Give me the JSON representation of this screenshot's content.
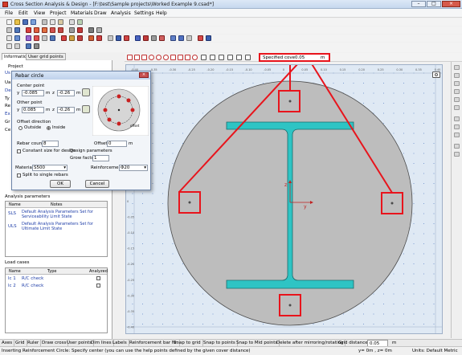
{
  "window": {
    "title": "Cross Section Analysis & Design - [F:\\test\\Sample projects\\Worked Example 9.csad*]",
    "btn_min": "–",
    "btn_max": "□",
    "btn_close": "×"
  },
  "menu": [
    "File",
    "Edit",
    "View",
    "Project",
    "Materials",
    "Draw",
    "Analysis",
    "Settings",
    "Help"
  ],
  "left_tabs": [
    "Information",
    "User grid points"
  ],
  "left_panel": {
    "project_label": "Project",
    "partial_labels": [
      "Us",
      "Ua",
      "De",
      "Ty",
      "Re",
      "Ex",
      "Gr",
      "Ce"
    ],
    "analysis_section": "Analysis parameters",
    "analysis_cols": [
      "Name",
      "Notes"
    ],
    "analysis_rows": [
      {
        "name": "SLS",
        "notes": "Default Analysis Parameters Set for Serviceability Limit State"
      },
      {
        "name": "ULS",
        "notes": "Default Analysis Parameters Set for Ultimate Limit State"
      }
    ],
    "load_section": "Load cases",
    "load_cols": [
      "Name",
      "Type",
      "Analyzed"
    ],
    "load_rows": [
      {
        "name": "lc 1",
        "type": "R/C check"
      },
      {
        "name": "lc 2",
        "type": "R/C check"
      }
    ]
  },
  "cover": {
    "label": "Specified cover",
    "value": "0.05",
    "unit": "m"
  },
  "dialog": {
    "title": "Rebar circle",
    "center_label": "Center point",
    "other_label": "Other point",
    "y_label": "y",
    "z_label": "z",
    "unit_m": "m",
    "center_y": "-0.085",
    "center_z": "-0.26",
    "other_y": "0.085",
    "other_z": "-0.26",
    "offset_dir_label": "Offset direction",
    "outside_label": "Outside",
    "inside_label": "Inside",
    "offset_caption": "offset",
    "rebar_count_label": "Rebar count",
    "rebar_count_value": "8",
    "offset_label": "Offset",
    "offset_value": "0",
    "constant_size_label": "Constant size for design",
    "design_params_label": "Design parameters",
    "grow_factor_label": "Grow factor",
    "grow_factor_value": "1",
    "material_label": "Material",
    "material_value": "S500",
    "reinforcement_label": "Reinforcement",
    "reinforcement_value": "Φ20",
    "split_label": "Split to single rebars",
    "ok": "OK",
    "cancel": "Cancel"
  },
  "axes": {
    "y": "y",
    "z": "z"
  },
  "ruler_top": [
    "-0.40",
    "-0.35",
    "-0.30",
    "-0.25",
    "-0.20",
    "-0.15",
    "-0.10",
    "-0.05",
    "0",
    "0.05",
    "0.10",
    "0.15",
    "0.20",
    "0.25",
    "0.30",
    "0.35",
    "0.40"
  ],
  "ruler_left": [
    "0.40",
    "0.35",
    "0.30",
    "0.25",
    "0.20",
    "0.15",
    "0.10",
    "0.05",
    "0",
    "-0.05",
    "-0.10",
    "-0.15",
    "-0.20",
    "-0.25",
    "-0.30",
    "-0.35",
    "-0.40"
  ],
  "bottom_toolbar": [
    "Axes",
    "Grid",
    "Ruler",
    "Draw cross",
    "User points",
    "Dim lines",
    "Labels",
    "Reinforcement bar Nr.",
    "Snap to grid",
    "Snap to points",
    "Snap to Mid points",
    "Delete after mirroring/rotating",
    "Grid distance:",
    "0.05",
    "m"
  ],
  "status": {
    "message": "Inserting Reinforcement Circle: Specify center (you can use the help points defined by the given cover distance)",
    "coords": "y= 0m , z= 0m",
    "units": "Units: Default Metric"
  },
  "colors": {
    "section_fill": "#bdbdbd",
    "steel_fill": "#2ec4c4",
    "highlight": "#e8141c",
    "canvas_bg": "#dfe9f4",
    "grid_line": "#8fa9d6"
  }
}
